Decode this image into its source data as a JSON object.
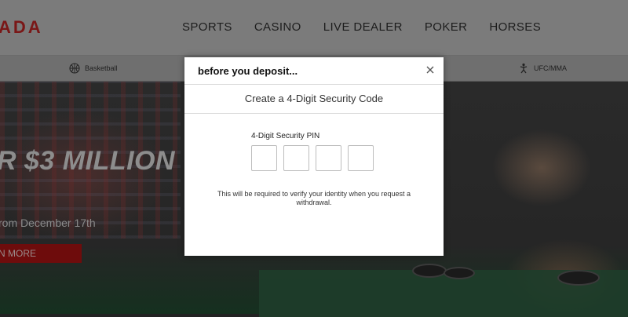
{
  "brand": {
    "logo_text": "ADA"
  },
  "nav": {
    "items": [
      "SPORTS",
      "CASINO",
      "LIVE DEALER",
      "POKER",
      "HORSES"
    ]
  },
  "subnav": {
    "basketball": {
      "label": "Basketball",
      "icon": "basketball-icon"
    },
    "ufc": {
      "label": "UFC/MMA",
      "icon": "fighter-icon"
    }
  },
  "hero": {
    "title": "R $3 MILLION",
    "subtitle": "rom December 17th",
    "button_label": "N MORE"
  },
  "modal": {
    "title": "before you deposit...",
    "subtitle": "Create a 4-Digit Security Code",
    "pin_label": "4-Digit Security PIN",
    "pin_digits": [
      "",
      "",
      "",
      ""
    ],
    "note": "This will be required to verify your identity when you request a withdrawal."
  },
  "colors": {
    "brand_red": "#7a1717",
    "hero_button": "#6e0c0c",
    "modal_bg": "#ffffff",
    "overlay_nav": "#7b7b7b"
  }
}
